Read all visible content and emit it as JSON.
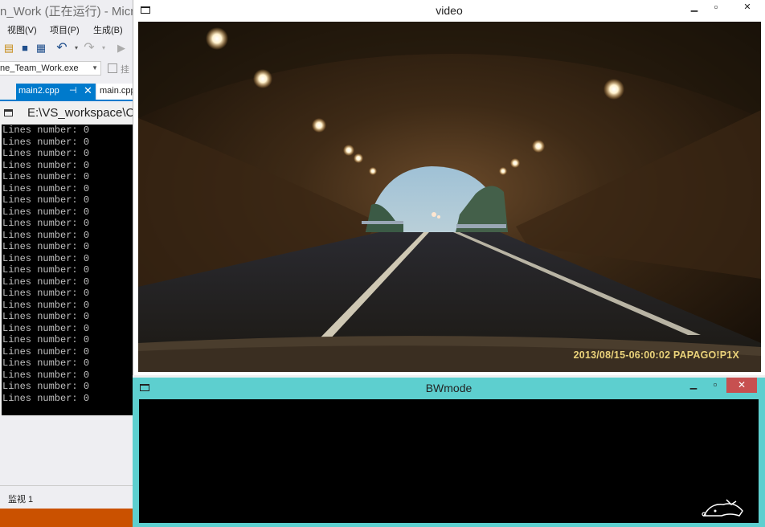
{
  "vs": {
    "title": "n_Work (正在运行) - Micro",
    "menu": [
      "视图(V)",
      "项目(P)",
      "生成(B)"
    ],
    "target_exe": "ne_Team_Work.exe",
    "attach_label": "挂",
    "tabs": [
      {
        "label": "main2.cpp",
        "active": true,
        "pin": "⊣",
        "close": "✕"
      },
      {
        "label": "main.cpp",
        "active": false
      }
    ],
    "watch_label": "监视 1",
    "accent": "#007acc",
    "status_color": "#ca5100"
  },
  "console": {
    "title": "E:\\VS_workspace\\C+",
    "lines": [
      "Lines number: 0",
      "Lines number: 0",
      "Lines number: 0",
      "Lines number: 0",
      "Lines number: 0",
      "Lines number: 0",
      "Lines number: 0",
      "Lines number: 0",
      "Lines number: 0",
      "Lines number: 0",
      "Lines number: 0",
      "Lines number: 0",
      "Lines number: 0",
      "Lines number: 0",
      "Lines number: 0",
      "Lines number: 0",
      "Lines number: 0",
      "Lines number: 0",
      "Lines number: 0",
      "Lines number: 0",
      "Lines number: 0",
      "Lines number: 0",
      "Lines number: 0",
      "Lines number: 0"
    ]
  },
  "video": {
    "title": "video",
    "timestamp": "2013/08/15-06:00:02 PAPAGO!P1X",
    "minimize": "▁",
    "maximize": "▫",
    "close": "✕"
  },
  "bwmode": {
    "title": "BWmode",
    "minimize": "▁",
    "maximize": "▫",
    "close": "✕",
    "frame_color": "#5dcfcf"
  }
}
